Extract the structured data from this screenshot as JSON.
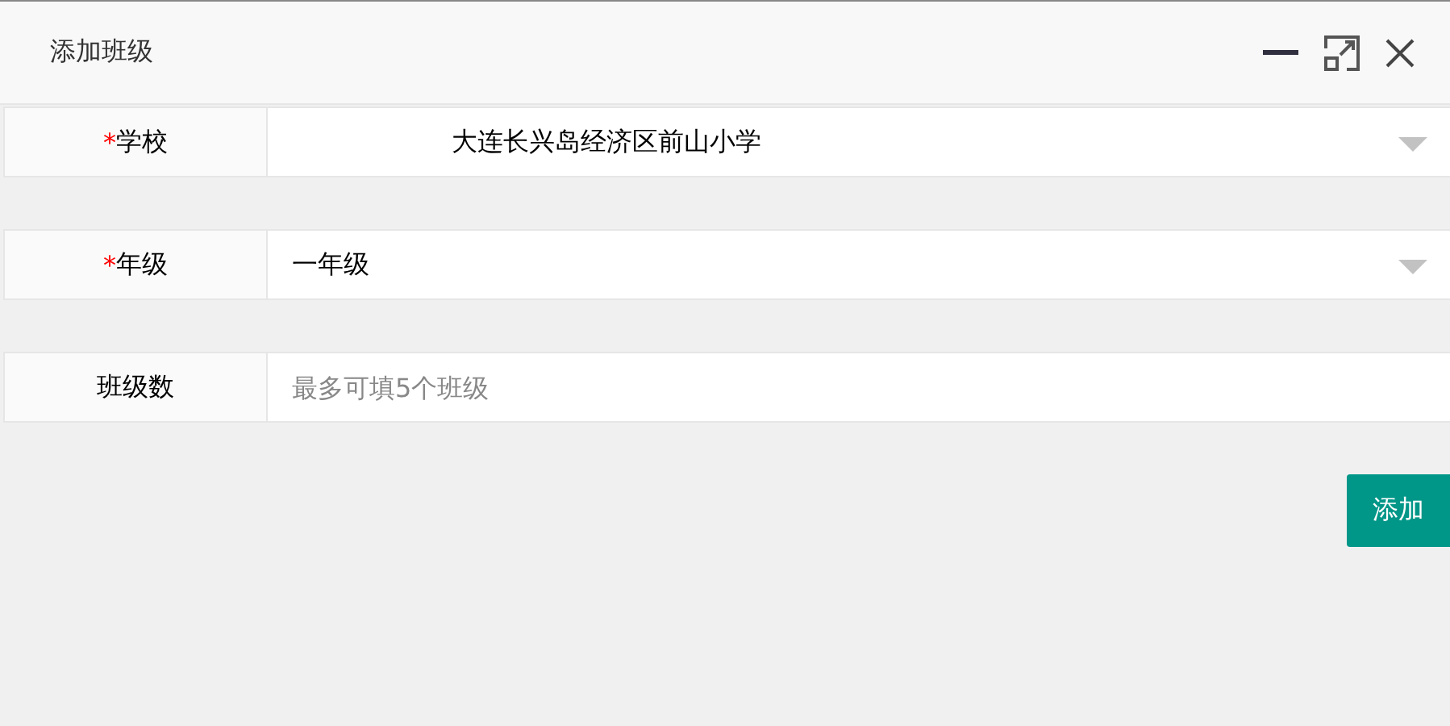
{
  "window": {
    "title": "添加班级"
  },
  "fields": [
    {
      "kind": "select",
      "label": "学校",
      "required_mark": "*",
      "value": "大连长兴岛经济区前山小学",
      "indent": true
    },
    {
      "kind": "select",
      "label": "年级",
      "required_mark": "*",
      "value": "一年级",
      "indent": false
    },
    {
      "kind": "input",
      "label": "班级数",
      "placeholder": "最多可填5个班级"
    }
  ],
  "submit_button": "添加"
}
